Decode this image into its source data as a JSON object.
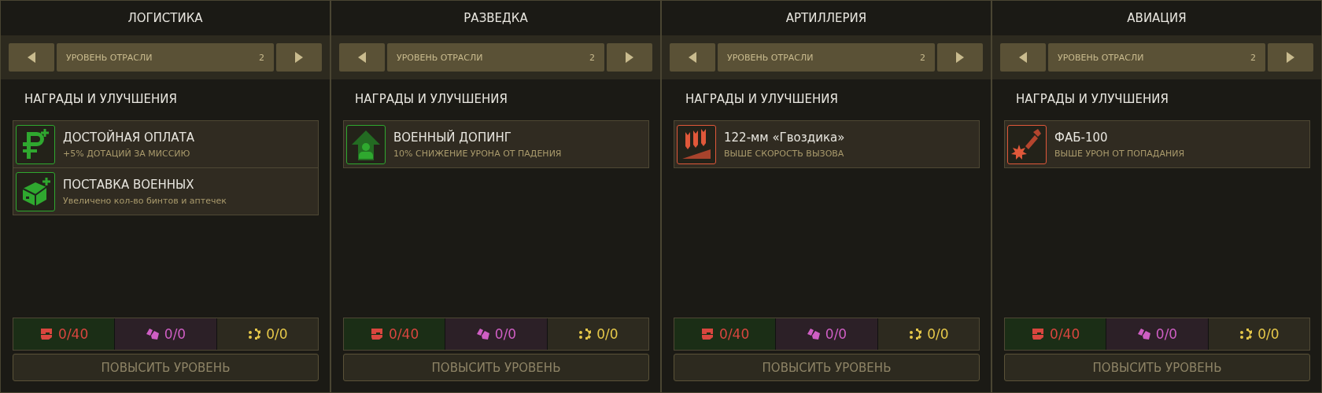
{
  "panels": [
    {
      "title": "ЛОГИСТИКА",
      "level_label": "УРОВЕНЬ ОТРАСЛИ",
      "level_value": "2",
      "section_title": "НАГРАДЫ И УЛУЧШЕНИЯ",
      "rewards": [
        {
          "kind": "ruble",
          "color": "#2fa82f",
          "name": "ДОСТОЙНАЯ ОПЛАТА",
          "description": "+5% ДОТАЦИЙ ЗА МИССИЮ"
        },
        {
          "kind": "box",
          "color": "#2fa82f",
          "name": "ПОСТАВКА ВОЕННЫХ",
          "description": "Увеличено кол-во бинтов и аптечек"
        }
      ],
      "resources": [
        {
          "kind": "supplies",
          "value": "0/40"
        },
        {
          "kind": "materials",
          "value": "0/0"
        },
        {
          "kind": "parts",
          "value": "0/0"
        }
      ],
      "upgrade_button": "ПОВЫСИТЬ УРОВЕНЬ"
    },
    {
      "title": "РАЗВЕДКА",
      "level_label": "УРОВЕНЬ ОТРАСЛИ",
      "level_value": "2",
      "section_title": "НАГРАДЫ И УЛУЧШЕНИЯ",
      "rewards": [
        {
          "kind": "booster",
          "color": "#2fa82f",
          "name": "ВОЕННЫЙ ДОПИНГ",
          "description": "10% СНИЖЕНИЕ УРОНА ОТ ПАДЕНИЯ"
        }
      ],
      "resources": [
        {
          "kind": "supplies",
          "value": "0/40"
        },
        {
          "kind": "materials",
          "value": "0/0"
        },
        {
          "kind": "parts",
          "value": "0/0"
        }
      ],
      "upgrade_button": "ПОВЫСИТЬ УРОВЕНЬ"
    },
    {
      "title": "АРТИЛЛЕРИЯ",
      "level_label": "УРОВЕНЬ ОТРАСЛИ",
      "level_value": "2",
      "section_title": "НАГРАДЫ И УЛУЧШЕНИЯ",
      "rewards": [
        {
          "kind": "artillery",
          "color": "#e0583a",
          "name": "122-мм «Гвоздика»",
          "description": "ВЫШЕ СКОРОСТЬ ВЫЗОВА"
        }
      ],
      "resources": [
        {
          "kind": "supplies",
          "value": "0/40"
        },
        {
          "kind": "materials",
          "value": "0/0"
        },
        {
          "kind": "parts",
          "value": "0/0"
        }
      ],
      "upgrade_button": "ПОВЫСИТЬ УРОВЕНЬ"
    },
    {
      "title": "АВИАЦИЯ",
      "level_label": "УРОВЕНЬ ОТРАСЛИ",
      "level_value": "2",
      "section_title": "НАГРАДЫ И УЛУЧШЕНИЯ",
      "rewards": [
        {
          "kind": "bomb",
          "color": "#e0583a",
          "name": "ФАБ-100",
          "description": "ВЫШЕ УРОН ОТ ПОПАДАНИЯ"
        }
      ],
      "resources": [
        {
          "kind": "supplies",
          "value": "0/40"
        },
        {
          "kind": "materials",
          "value": "0/0"
        },
        {
          "kind": "parts",
          "value": "0/0"
        }
      ],
      "upgrade_button": "ПОВЫСИТЬ УРОВЕНЬ"
    }
  ]
}
